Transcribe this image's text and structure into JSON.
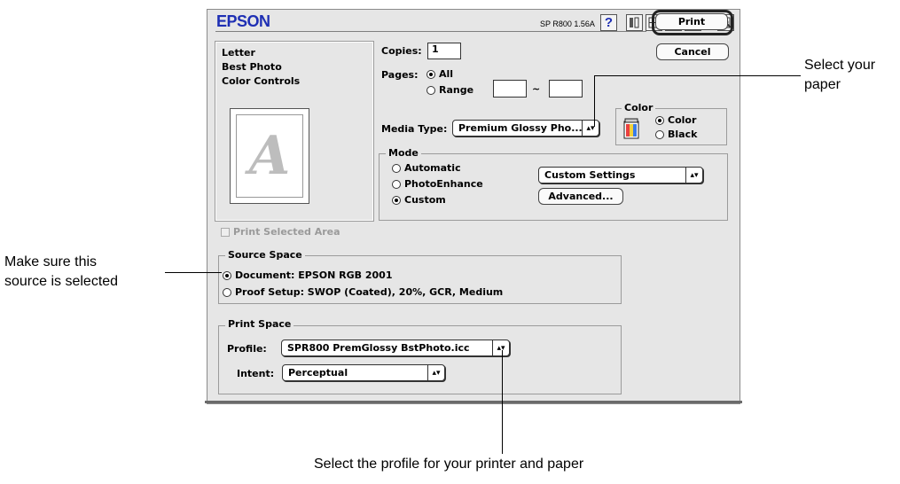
{
  "dialog": {
    "brand": "EPSON",
    "version": "SP R800 1.56A",
    "help_icon_glyph": "?",
    "print_label": "Print",
    "cancel_label": "Cancel",
    "summary": [
      "Letter",
      "Best Photo",
      "Color Controls"
    ],
    "preview_glyph": "A",
    "copies": {
      "label": "Copies:",
      "value": "1"
    },
    "pages": {
      "label": "Pages:",
      "all": "All",
      "range": "Range",
      "sep": "~",
      "selected": "All"
    },
    "media": {
      "label": "Media Type:",
      "value": "Premium Glossy Pho..."
    },
    "color": {
      "title": "Color",
      "options": [
        "Color",
        "Black"
      ],
      "selected": "Color"
    },
    "mode": {
      "title": "Mode",
      "options": [
        "Automatic",
        "PhotoEnhance",
        "Custom"
      ],
      "selected": "Custom",
      "settings_value": "Custom Settings",
      "advanced_label": "Advanced..."
    },
    "print_selected_area": "Print Selected Area",
    "source_space": {
      "title": "Source Space",
      "document": "Document: EPSON RGB 2001",
      "proof": "Proof Setup: SWOP (Coated), 20%, GCR, Medium",
      "selected": "document"
    },
    "print_space": {
      "title": "Print Space",
      "profile_label": "Profile:",
      "profile_value": "SPR800 PremGlossy BstPhoto.icc",
      "intent_label": "Intent:",
      "intent_value": "Perceptual"
    }
  },
  "callouts": {
    "select_paper": [
      "Select your",
      "paper"
    ],
    "source": [
      "Make sure this",
      "source is selected"
    ],
    "profile": "Select the profile for your printer and paper"
  }
}
